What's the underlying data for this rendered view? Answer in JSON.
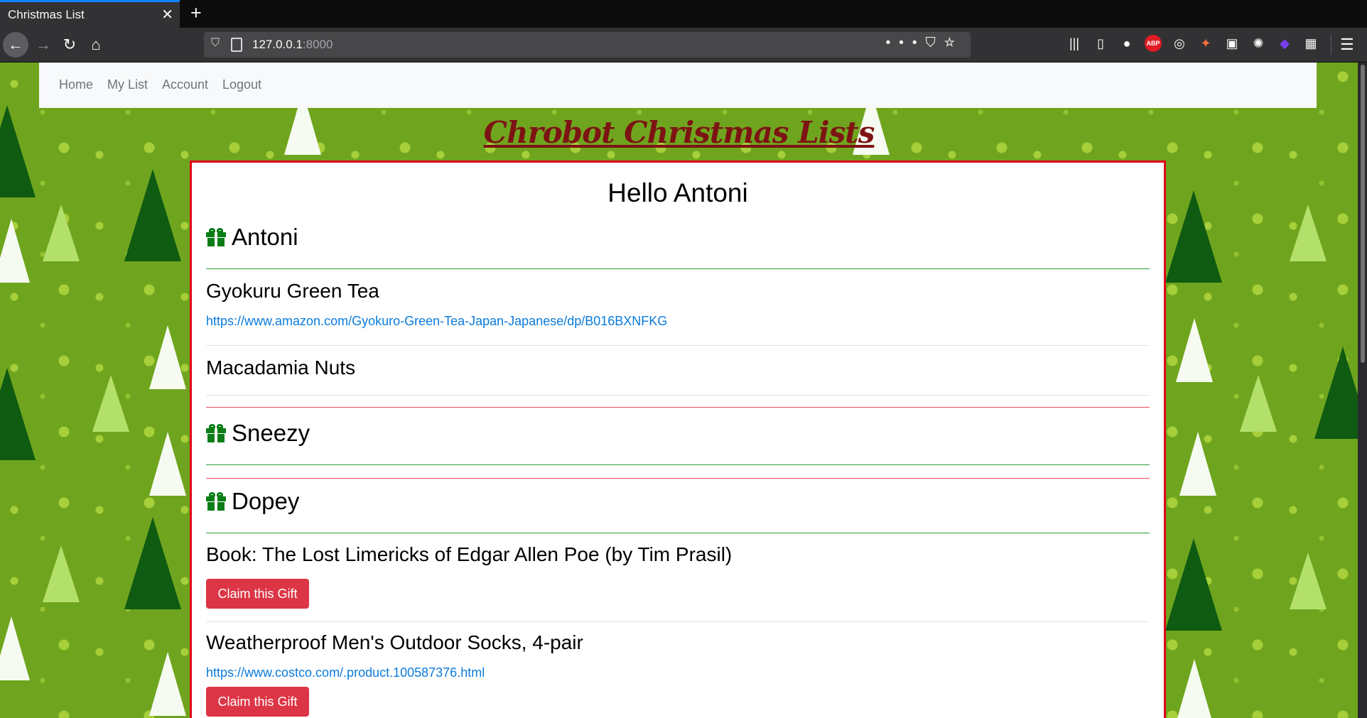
{
  "browser": {
    "tab_title": "Christmas List",
    "url_host": "127.0.0.1",
    "url_port": ":8000"
  },
  "site_nav": {
    "items": [
      "Home",
      "My List",
      "Account",
      "Logout"
    ]
  },
  "site_title": "Chrobot Christmas Lists",
  "greeting": "Hello Antoni",
  "lists": [
    {
      "person": "Antoni",
      "items": [
        {
          "title": "Gyokuru Green Tea",
          "link": "https://www.amazon.com/Gyokuro-Green-Tea-Japan-Japanese/dp/B016BXNFKG"
        },
        {
          "title": "Macadamia Nuts"
        }
      ]
    },
    {
      "person": "Sneezy",
      "items": []
    },
    {
      "person": "Dopey",
      "items": [
        {
          "title": "Book: The Lost Limericks of Edgar Allen Poe (by Tim Prasil)",
          "button": "Claim this Gift"
        },
        {
          "title": "Weatherproof Men's Outdoor Socks, 4-pair",
          "link": "https://www.costco.com/.product.100587376.html",
          "button": "Claim this Gift"
        }
      ]
    }
  ],
  "colors": {
    "claim_button": "#dc3545",
    "card_border": "#e0001b",
    "title": "#7d1414",
    "gift_icon": "#0a7d16"
  }
}
